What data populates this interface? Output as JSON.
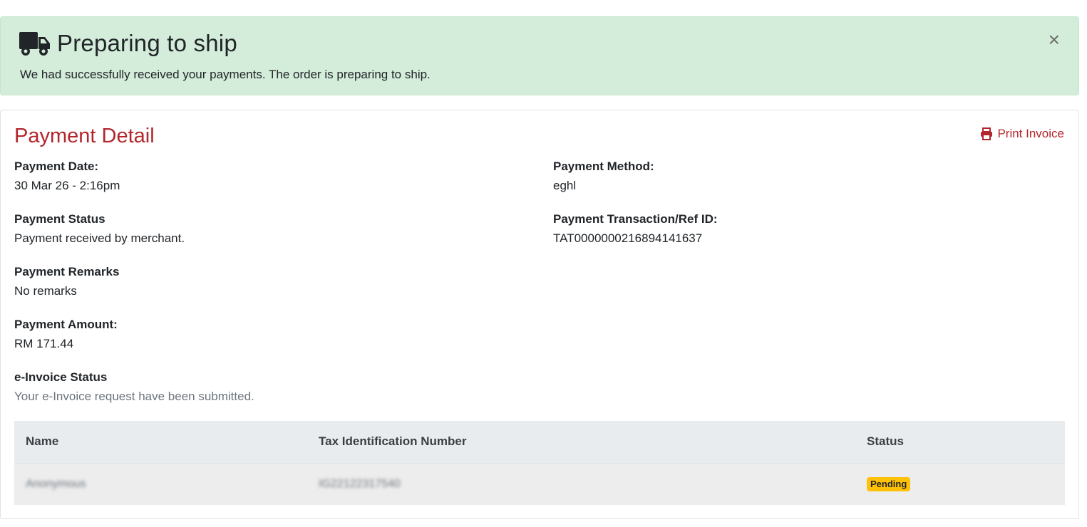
{
  "alert": {
    "title": "Preparing to ship",
    "message": "We had successfully received your payments. The order is preparing to ship.",
    "close_label": "×",
    "icon": "truck-icon"
  },
  "payment": {
    "title": "Payment Detail",
    "print_label": "Print Invoice",
    "print_icon": "print-icon",
    "date_label": "Payment Date:",
    "date_value": "30 Mar 26 - 2:16pm",
    "method_label": "Payment Method:",
    "method_value": "eghl",
    "status_label": "Payment Status",
    "status_value": "Payment received by merchant.",
    "ref_label": "Payment Transaction/Ref ID:",
    "ref_value": "TAT0000000216894141637",
    "remarks_label": "Payment Remarks",
    "remarks_value": "No remarks",
    "amount_label": "Payment Amount:",
    "amount_value": "RM 171.44",
    "einvoice_label": "e-Invoice Status",
    "einvoice_value": "Your e-Invoice request have been submitted."
  },
  "table": {
    "headers": [
      "Name",
      "Tax Identification Number",
      "Status"
    ],
    "rows": [
      {
        "name": "Anonymous",
        "tin": "IG22122317540",
        "status": "Pending"
      }
    ]
  },
  "colors": {
    "accent": "#b3262d",
    "alert_bg": "#d4ecda",
    "badge_pending": "#ffc107"
  }
}
